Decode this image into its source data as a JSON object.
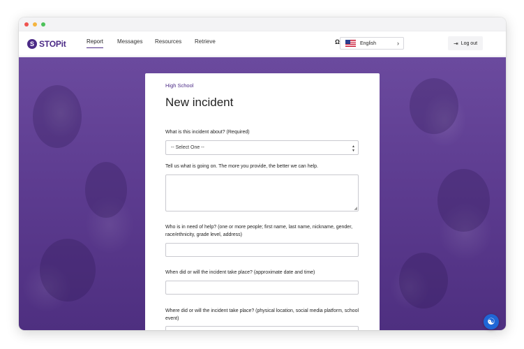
{
  "brand": {
    "name": "STOPit"
  },
  "nav": {
    "items": [
      {
        "label": "Report"
      },
      {
        "label": "Messages"
      },
      {
        "label": "Resources"
      },
      {
        "label": "Retrieve"
      }
    ]
  },
  "language": {
    "selected": "English"
  },
  "logout": {
    "label": "Log out"
  },
  "form": {
    "school": "High School",
    "title": "New incident",
    "q1_label": "What is this incident about? (Required)",
    "q1_value": "-- Select One --",
    "q2_label": "Tell us what is going on. The more you provide, the better we can help.",
    "q3_label": "Who is in need of help? (one or more people; first name, last name, nickname, gender, race/ethnicity, grade level, address)",
    "q4_label": "When did or will the incident take place? (approximate date and time)",
    "q5_label": "Where did or will the incident take place? (physical location, social media platform, school event)"
  },
  "colors": {
    "brand": "#4b2a86",
    "accessibility": "#1f66d6"
  }
}
